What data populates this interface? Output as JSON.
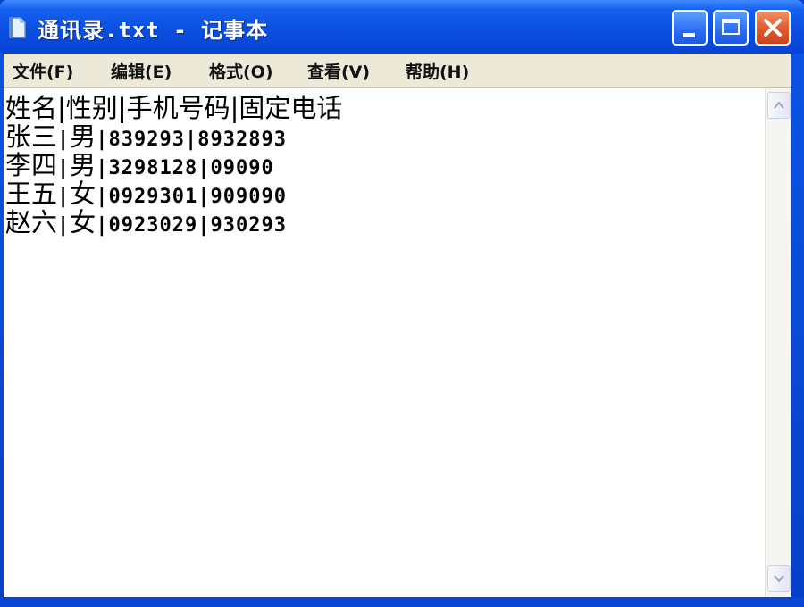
{
  "window": {
    "title": "通讯录.txt - 记事本"
  },
  "icons": {
    "app": "notepad-icon",
    "minimize": "minimize-icon",
    "maximize": "maximize-icon",
    "close": "close-icon",
    "scroll_up": "chevron-up-icon",
    "scroll_down": "chevron-down-icon"
  },
  "menu": [
    {
      "label": "文件(F)"
    },
    {
      "label": "编辑(E)"
    },
    {
      "label": "格式(O)"
    },
    {
      "label": "查看(V)"
    },
    {
      "label": "帮助(H)"
    }
  ],
  "document": {
    "header": {
      "name": "姓名",
      "gender": "性别",
      "mobile": "手机号码",
      "landline": "固定电话"
    },
    "rows": [
      {
        "name": "张三",
        "gender": "男",
        "mobile": "839293",
        "landline": "8932893"
      },
      {
        "name": "李四",
        "gender": "男",
        "mobile": "3298128",
        "landline": "09090"
      },
      {
        "name": "王五",
        "gender": "女",
        "mobile": "0929301",
        "landline": "909090"
      },
      {
        "name": "赵六",
        "gender": "女",
        "mobile": "0923029",
        "landline": "930293"
      }
    ],
    "separator": "|"
  },
  "colors": {
    "titlebar": "#0a4fe0",
    "close_button": "#df5a2c",
    "menubar": "#ece9d8",
    "editor_background": "#ffffff"
  }
}
